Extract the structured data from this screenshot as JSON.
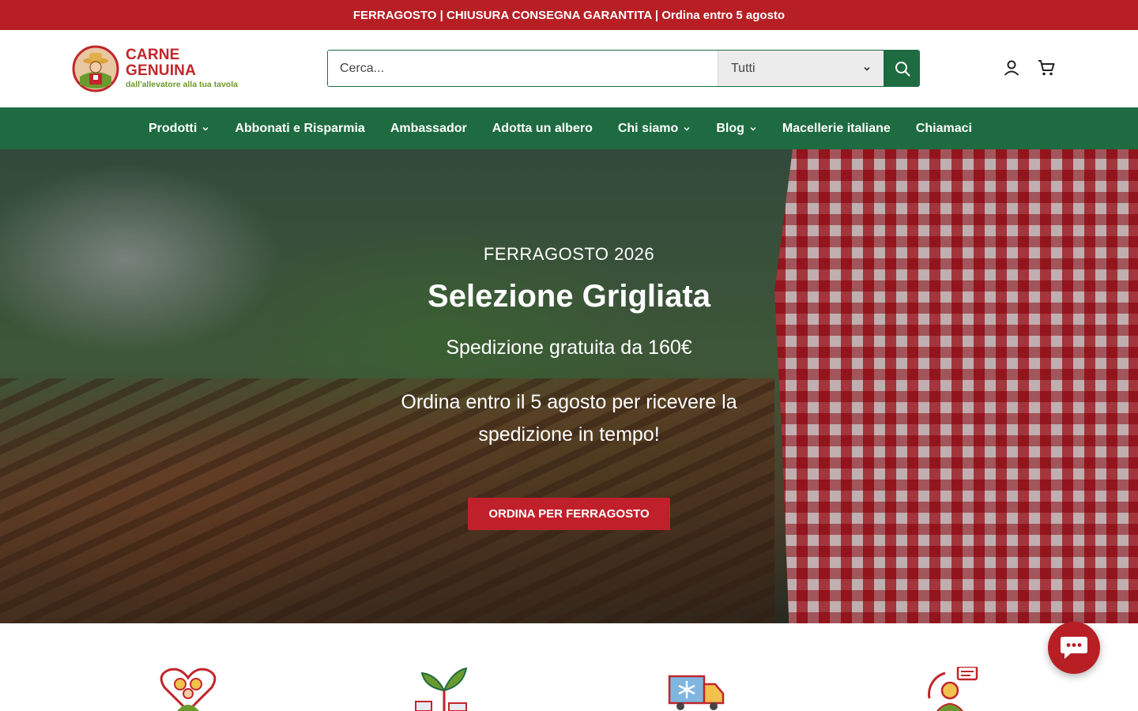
{
  "announcement": {
    "text": "FERRAGOSTO | CHIUSURA CONSEGNA GARANTITA | Ordina entro 5 agosto"
  },
  "header": {
    "logo": {
      "title": "CARNE GENUINA",
      "tagline": "dall'allevatore alla tua tavola"
    },
    "search": {
      "placeholder": "Cerca...",
      "category_selected": "Tutti"
    },
    "icons": [
      "account-icon",
      "cart-icon"
    ]
  },
  "nav": {
    "items": [
      {
        "label": "Prodotti",
        "has_dropdown": true
      },
      {
        "label": "Abbonati e Risparmia",
        "has_dropdown": false
      },
      {
        "label": "Ambassador",
        "has_dropdown": false
      },
      {
        "label": "Adotta un albero",
        "has_dropdown": false
      },
      {
        "label": "Chi siamo",
        "has_dropdown": true
      },
      {
        "label": "Blog",
        "has_dropdown": true
      },
      {
        "label": "Macellerie italiane",
        "has_dropdown": false
      },
      {
        "label": "Chiamaci",
        "has_dropdown": false
      }
    ]
  },
  "hero": {
    "eyebrow": "FERRAGOSTO 2026",
    "title": "Selezione Grigliata",
    "subtitle": "Spedizione gratuita da 160€",
    "description": "Ordina entro il 5 agosto per ricevere la spedizione in tempo!",
    "cta_label": "ORDINA PER FERRAGOSTO"
  },
  "features": {
    "icons": [
      "family-heart-icon",
      "plant-sprout-icon",
      "refrigerated-truck-icon",
      "customer-support-icon"
    ]
  },
  "colors": {
    "brand_red": "#b71f25",
    "brand_green": "#1e6b41",
    "accent_green": "#6b9a2e"
  }
}
